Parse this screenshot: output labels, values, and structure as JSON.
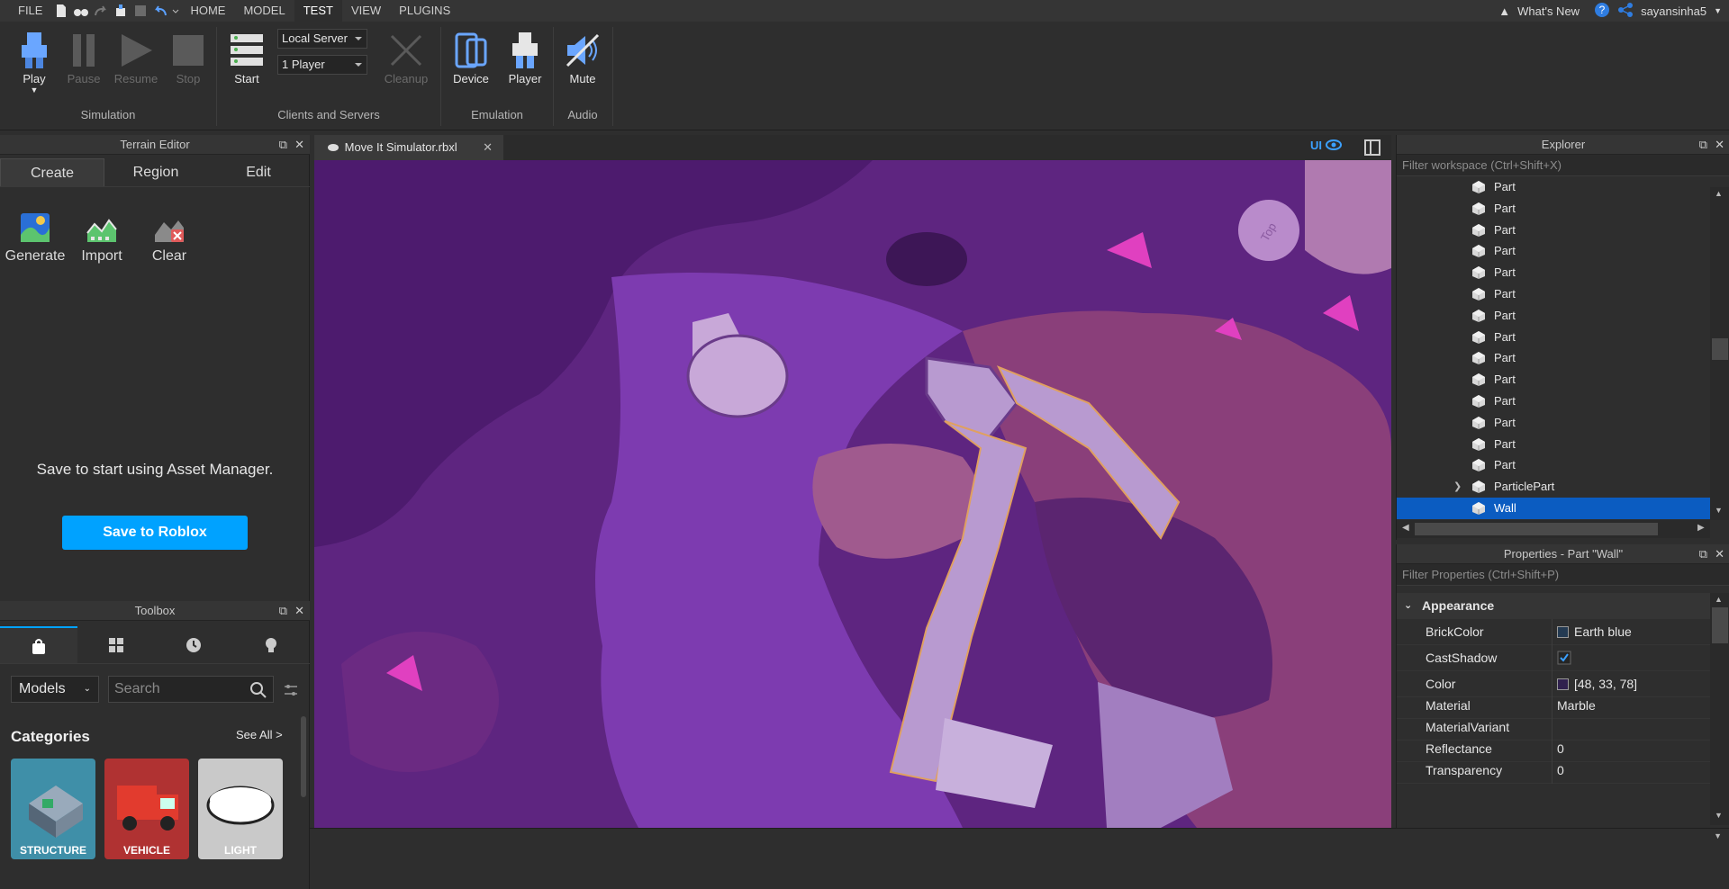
{
  "menubar": {
    "items": [
      "FILE",
      "HOME",
      "MODEL",
      "TEST",
      "VIEW",
      "PLUGINS"
    ],
    "active_index": 3,
    "whats_new": "What's New",
    "username": "sayansinha5"
  },
  "ribbon": {
    "play": "Play",
    "pause": "Pause",
    "resume": "Resume",
    "stop": "Stop",
    "start": "Start",
    "server_select": "Local Server",
    "players_select": "1 Player",
    "cleanup": "Cleanup",
    "device": "Device",
    "player": "Player",
    "mute": "Mute",
    "groups": {
      "simulation": "Simulation",
      "clients": "Clients and Servers",
      "emulation": "Emulation",
      "audio": "Audio"
    }
  },
  "terrain": {
    "title": "Terrain Editor",
    "tabs": [
      "Create",
      "Region",
      "Edit"
    ],
    "tools": [
      "Generate",
      "Import",
      "Clear"
    ],
    "message": "Save to start using Asset Manager.",
    "save_button": "Save to Roblox"
  },
  "toolbox": {
    "title": "Toolbox",
    "models_select": "Models",
    "search_placeholder": "Search",
    "categories_label": "Categories",
    "see_all": "See All >",
    "cards": [
      "STRUCTURE",
      "VEHICLE",
      "LIGHT"
    ]
  },
  "viewport": {
    "doc_tab": "Move It Simulator.rbxl",
    "ui_toggle": "UI",
    "gizmo_label": "Top"
  },
  "explorer": {
    "title": "Explorer",
    "filter_placeholder": "Filter workspace (Ctrl+Shift+X)",
    "rows": [
      "Part",
      "Part",
      "Part",
      "Part",
      "Part",
      "Part",
      "Part",
      "Part",
      "Part",
      "Part",
      "Part",
      "Part",
      "Part",
      "Part",
      "ParticlePart",
      "Wall"
    ],
    "selected": "Wall"
  },
  "properties": {
    "title": "Properties - Part \"Wall\"",
    "filter_placeholder": "Filter Properties (Ctrl+Shift+P)",
    "section": "Appearance",
    "rows": [
      {
        "name": "BrickColor",
        "value": "Earth blue",
        "swatch": "#243a52"
      },
      {
        "name": "CastShadow",
        "value": "",
        "checked": true
      },
      {
        "name": "Color",
        "value": "[48, 33, 78]",
        "swatch": "#30214e"
      },
      {
        "name": "Material",
        "value": "Marble"
      },
      {
        "name": "MaterialVariant",
        "value": ""
      },
      {
        "name": "Reflectance",
        "value": "0"
      },
      {
        "name": "Transparency",
        "value": "0"
      }
    ]
  },
  "colors": {
    "accent": "#00a2ff",
    "selection": "#0b5cc1",
    "panel": "#2e2e2e"
  }
}
